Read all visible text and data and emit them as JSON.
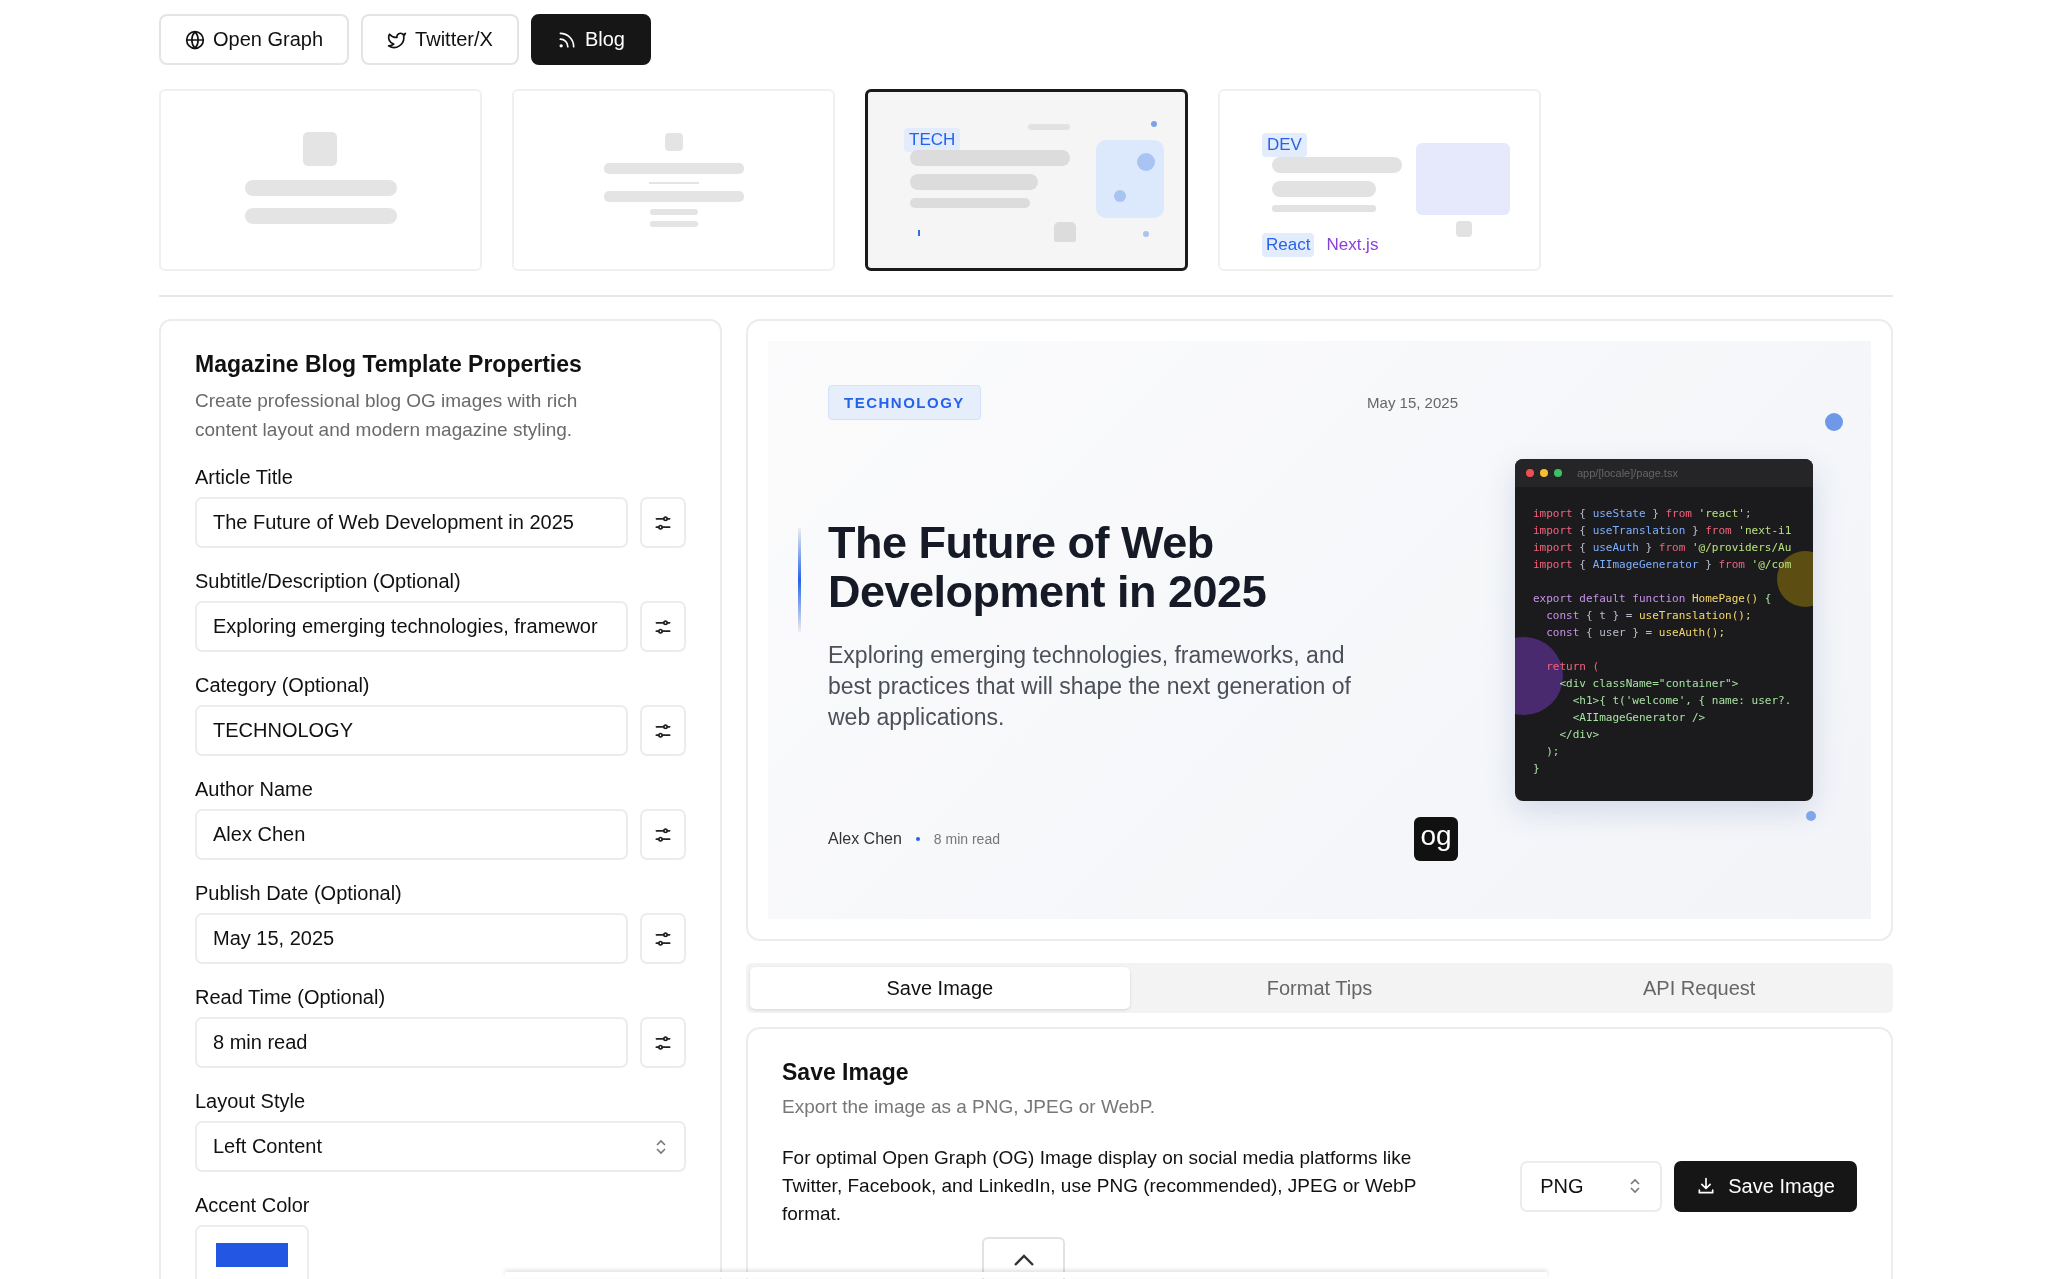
{
  "platform_tabs": [
    {
      "label": "Open Graph",
      "selected": false
    },
    {
      "label": "Twitter/X",
      "selected": false
    },
    {
      "label": "Blog",
      "selected": true
    }
  ],
  "templates": [
    {
      "kind": "minimal",
      "selected": false
    },
    {
      "kind": "classic",
      "selected": false
    },
    {
      "kind": "tech",
      "selected": true,
      "tag": "TECH"
    },
    {
      "kind": "dev",
      "selected": false,
      "tag": "DEV",
      "chips": [
        "React",
        "Next.js"
      ]
    }
  ],
  "properties": {
    "title": "Magazine Blog Template Properties",
    "description": "Create professional blog OG images with rich content layout and modern magazine styling.",
    "fields": [
      {
        "kind": "text",
        "label": "Article Title",
        "value": "The Future of Web Development in 2025"
      },
      {
        "kind": "text",
        "label": "Subtitle/Description (Optional)",
        "value": "Exploring emerging technologies, framewor"
      },
      {
        "kind": "text",
        "label": "Category (Optional)",
        "value": "TECHNOLOGY"
      },
      {
        "kind": "text",
        "label": "Author Name",
        "value": "Alex Chen"
      },
      {
        "kind": "text",
        "label": "Publish Date (Optional)",
        "value": "May 15, 2025"
      },
      {
        "kind": "text",
        "label": "Read Time (Optional)",
        "value": "8 min read"
      },
      {
        "kind": "select",
        "label": "Layout Style",
        "value": "Left Content"
      },
      {
        "kind": "color",
        "label": "Accent Color",
        "color": "#2357e3"
      }
    ]
  },
  "preview": {
    "category": "TECHNOLOGY",
    "date": "May 15, 2025",
    "title": "The Future of Web Development in 2025",
    "subtitle": "Exploring emerging technologies, frameworks, and best practices that will shape the next generation of web applications.",
    "author": "Alex Chen",
    "read_time": "8 min read",
    "logo": "og",
    "code_window": {
      "filename": "app/[locale]/page.tsx",
      "lines": [
        {
          "kind": "code",
          "tokens": [
            {
              "text": "import",
              "kind": "keyword"
            },
            {
              "text": " { ",
              "kind": "punct"
            },
            {
              "text": "useState",
              "kind": "name"
            },
            {
              "text": " } ",
              "kind": "punct"
            },
            {
              "text": "from",
              "kind": "keyword"
            },
            {
              "text": " 'react'",
              "kind": "string"
            },
            {
              "text": ";",
              "kind": "punct"
            }
          ]
        },
        {
          "kind": "code",
          "tokens": [
            {
              "text": "import",
              "kind": "keyword"
            },
            {
              "text": " { ",
              "kind": "punct"
            },
            {
              "text": "useTranslation",
              "kind": "name"
            },
            {
              "text": " } ",
              "kind": "punct"
            },
            {
              "text": "from",
              "kind": "keyword"
            },
            {
              "text": " 'next-i1",
              "kind": "string"
            }
          ]
        },
        {
          "kind": "code",
          "tokens": [
            {
              "text": "import",
              "kind": "keyword"
            },
            {
              "text": " { ",
              "kind": "punct"
            },
            {
              "text": "useAuth",
              "kind": "name"
            },
            {
              "text": " } ",
              "kind": "punct"
            },
            {
              "text": "from",
              "kind": "keyword"
            },
            {
              "text": " '@/providers/Au",
              "kind": "string"
            }
          ]
        },
        {
          "kind": "code",
          "tokens": [
            {
              "text": "import",
              "kind": "keyword"
            },
            {
              "text": " { ",
              "kind": "punct"
            },
            {
              "text": "AIImageGenerator",
              "kind": "name"
            },
            {
              "text": " } ",
              "kind": "punct"
            },
            {
              "text": "from",
              "kind": "keyword"
            },
            {
              "text": " '@/com",
              "kind": "string"
            }
          ]
        },
        {
          "kind": "blank"
        },
        {
          "kind": "code",
          "tokens": [
            {
              "text": "export default function ",
              "kind": "decl"
            },
            {
              "text": "HomePage() ",
              "kind": "func"
            },
            {
              "text": "{",
              "kind": "markup"
            }
          ]
        },
        {
          "kind": "code",
          "tokens": [
            {
              "text": "  const",
              "kind": "decl"
            },
            {
              "text": " { t } = ",
              "kind": "punct"
            },
            {
              "text": "useTranslation();",
              "kind": "func"
            }
          ]
        },
        {
          "kind": "code",
          "tokens": [
            {
              "text": "  const",
              "kind": "decl"
            },
            {
              "text": " { user } = ",
              "kind": "punct"
            },
            {
              "text": "useAuth();",
              "kind": "func"
            }
          ]
        },
        {
          "kind": "blank"
        },
        {
          "kind": "code",
          "tokens": [
            {
              "text": "  return (",
              "kind": "keyword"
            }
          ]
        },
        {
          "kind": "code",
          "tokens": [
            {
              "text": "    <div className=\"container\">",
              "kind": "markup"
            }
          ]
        },
        {
          "kind": "code",
          "tokens": [
            {
              "text": "      <h1>{ t('welcome', { name: user?.",
              "kind": "markup"
            }
          ]
        },
        {
          "kind": "code",
          "tokens": [
            {
              "text": "      <AIImageGenerator />",
              "kind": "markup"
            }
          ]
        },
        {
          "kind": "code",
          "tokens": [
            {
              "text": "    </div>",
              "kind": "markup"
            }
          ]
        },
        {
          "kind": "code",
          "tokens": [
            {
              "text": "  );",
              "kind": "markup"
            }
          ]
        },
        {
          "kind": "code",
          "tokens": [
            {
              "text": "}",
              "kind": "markup"
            }
          ]
        }
      ]
    }
  },
  "action_tabs": [
    {
      "label": "Save Image",
      "selected": true
    },
    {
      "label": "Format Tips",
      "selected": false
    },
    {
      "label": "API Request",
      "selected": false
    }
  ],
  "save_panel": {
    "title": "Save Image",
    "subtitle": "Export the image as a PNG, JPEG or WebP.",
    "body": "For optimal Open Graph (OG) Image display on social media platforms like Twitter, Facebook, and LinkedIn, use PNG (recommended), JPEG or WebP format.",
    "format": "PNG",
    "button": "Save Image"
  }
}
